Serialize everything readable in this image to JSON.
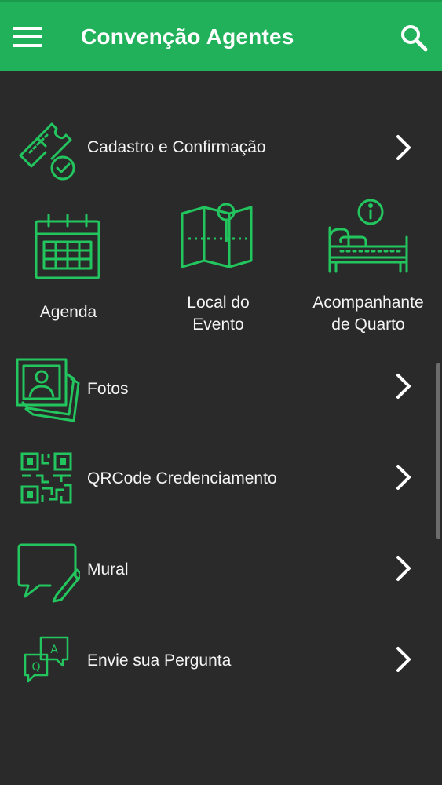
{
  "appbar": {
    "title": "Convenção Agentes",
    "menu_icon": "hamburger-menu-icon",
    "search_icon": "search-icon"
  },
  "colors": {
    "appbar": "#21b15a",
    "background": "#2b2a2a",
    "icon_stroke": "#22c55e",
    "text": "#f4f4f4"
  },
  "menu": {
    "cadastro": {
      "label": "Cadastro e Confirmação",
      "icon": "ticket-check-icon"
    },
    "agenda": {
      "label": "Agenda",
      "icon": "calendar-icon"
    },
    "local": {
      "label_line1": "Local do",
      "label_line2": "Evento",
      "icon": "map-pin-icon"
    },
    "acompanhante": {
      "label_line1": "Acompanhante",
      "label_line2": "de Quarto",
      "icon": "bed-info-icon"
    },
    "fotos": {
      "label": "Fotos",
      "icon": "photos-icon"
    },
    "qrcode": {
      "label": "QRCode Credenciamento",
      "icon": "qrcode-icon"
    },
    "mural": {
      "label": "Mural",
      "icon": "message-board-icon"
    },
    "pergunta": {
      "label": "Envie sua Pergunta",
      "icon": "question-answer-icon",
      "bubble_a": "A",
      "bubble_q": "Q"
    }
  }
}
